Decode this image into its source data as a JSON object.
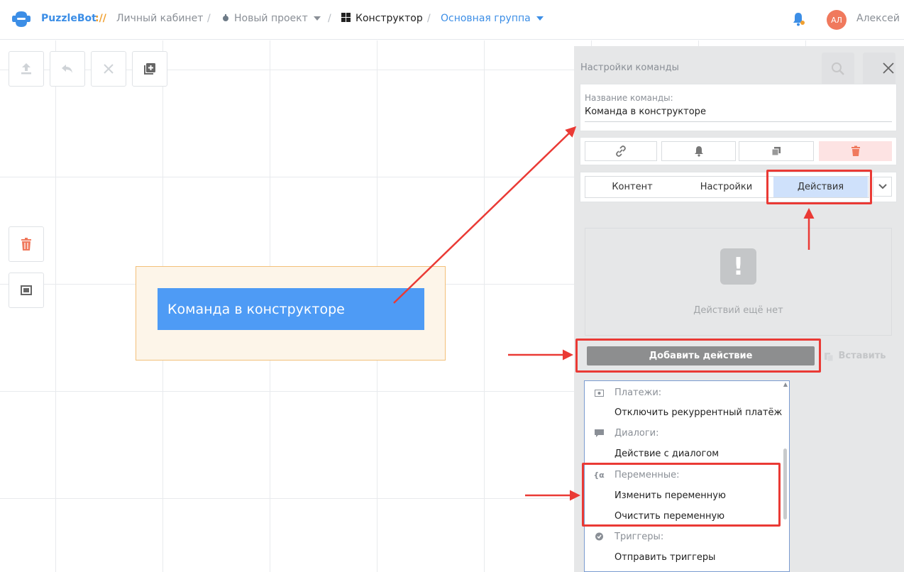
{
  "header": {
    "brand": "PuzzleBot",
    "brand_sep": "://",
    "crumb_cabinet": "Личный кабинет",
    "crumb_project": "Новый проект",
    "crumb_constructor": "Конструктор",
    "crumb_group": "Основная группа",
    "user_initials": "АЛ",
    "user_name": "Алексей"
  },
  "canvas": {
    "node_title": "Команда в конструкторе"
  },
  "panel": {
    "title": "Настройки команды",
    "name_label": "Название команды:",
    "name_value": "Команда в конструкторе",
    "tabs": [
      "Контент",
      "Настройки",
      "Действия"
    ],
    "selected_tab": "Действия",
    "empty_text": "Действий ещё нет",
    "add_action": "Добавить действие",
    "paste": "Вставить"
  },
  "dropdown": {
    "payments_group": "Платежи:",
    "payments_item": "Отключить рекуррентный платёж",
    "dialogs_group": "Диалоги:",
    "dialogs_item": "Действие с диалогом",
    "variables_group": "Переменные:",
    "variables_item_1": "Изменить переменную",
    "variables_item_2": "Очистить переменную",
    "triggers_group": "Триггеры:",
    "triggers_item": "Отправить триггеры"
  },
  "colors": {
    "accent": "#3c8ee6",
    "node_blue": "#4e9bf5",
    "danger": "#f0795d",
    "annotation_red": "#ea3a35"
  }
}
